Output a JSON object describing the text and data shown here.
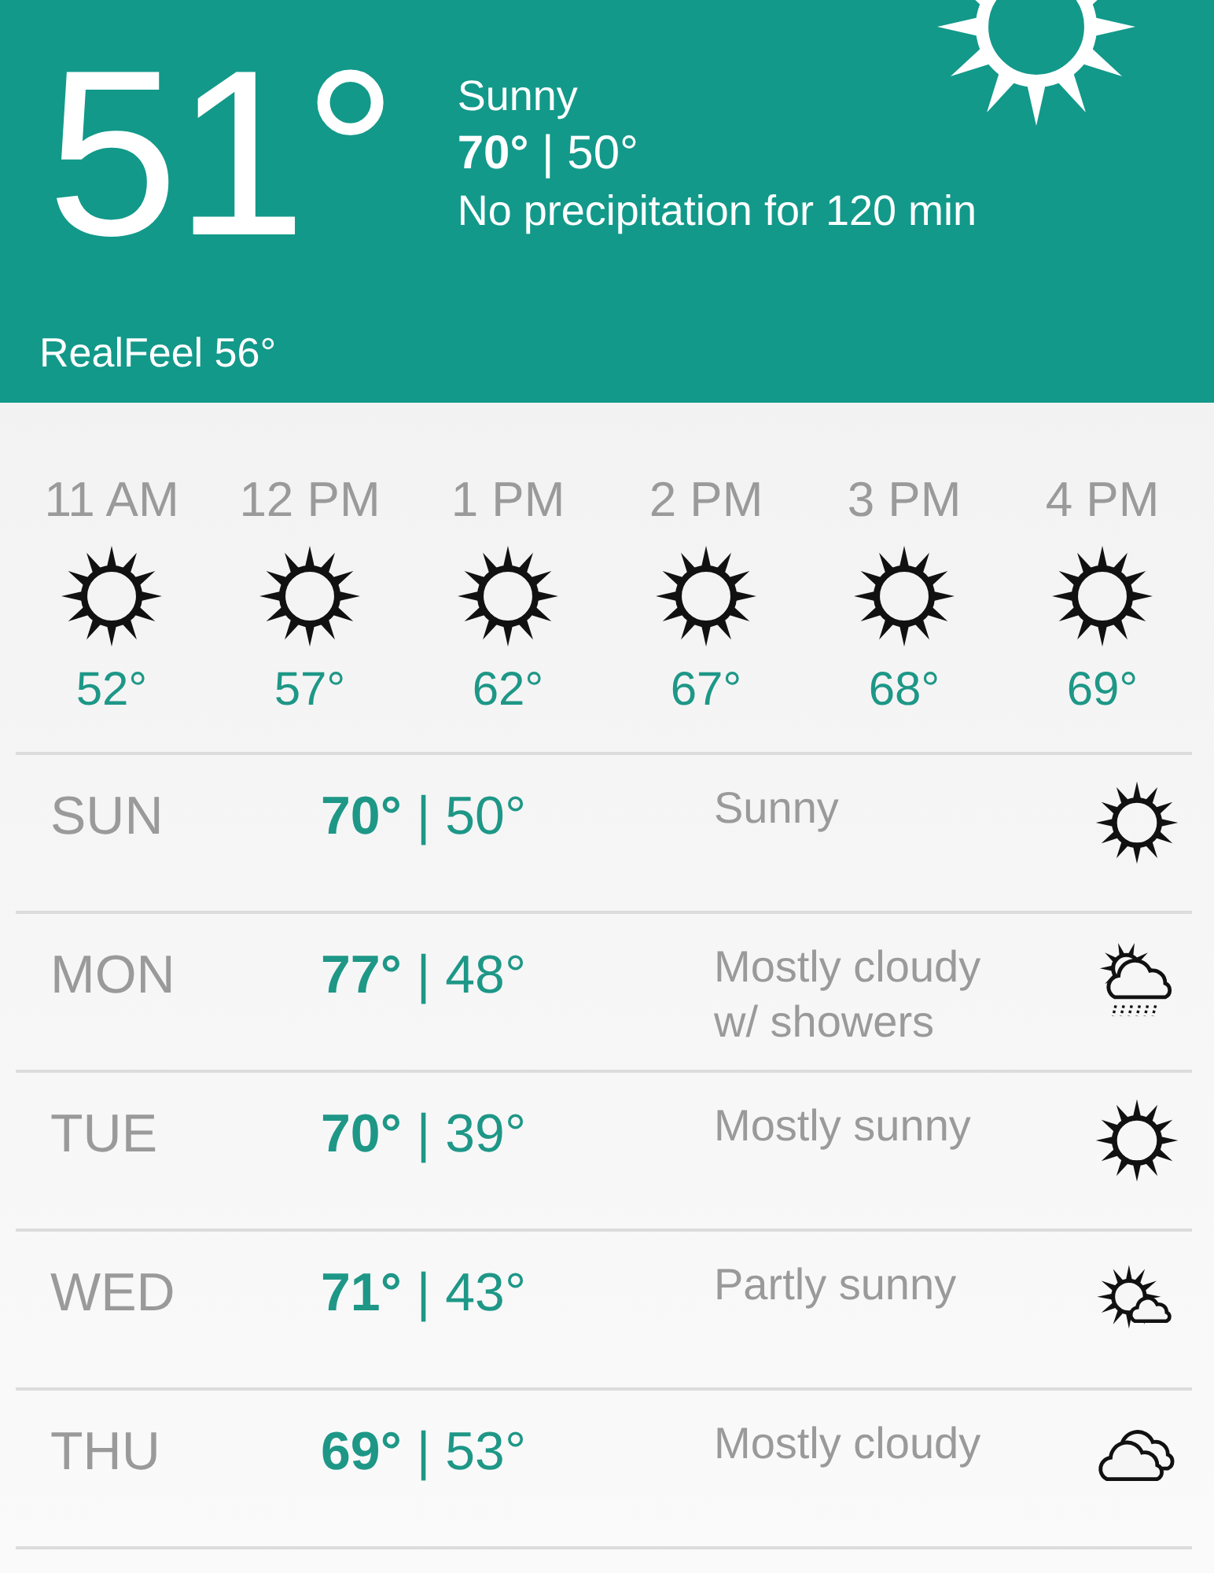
{
  "current": {
    "temperature": "51°",
    "kind": "sunny",
    "condition": "Sunny",
    "high_low": "**70°** | 50°",
    "precipitation": "No precipitation for 120 min",
    "realfeel": "RealFeel 56°"
  },
  "hourly": [
    {
      "time": "11 AM",
      "kind": "sunny",
      "temperature": "52°"
    },
    {
      "time": "12 PM",
      "kind": "sunny",
      "temperature": "57°"
    },
    {
      "time": "1 PM",
      "kind": "sunny",
      "temperature": "62°"
    },
    {
      "time": "2 PM",
      "kind": "sunny",
      "temperature": "67°"
    },
    {
      "time": "3 PM",
      "kind": "sunny",
      "temperature": "68°"
    },
    {
      "time": "4 PM",
      "kind": "sunny",
      "temperature": "69°"
    }
  ],
  "daily": [
    {
      "day": "SUN",
      "high_low": "**70°** | 50°",
      "condition": "Sunny",
      "kind": "sunny"
    },
    {
      "day": "MON",
      "high_low": "**77°** | 48°",
      "condition": "Mostly cloudy w/ showers",
      "kind": "showers"
    },
    {
      "day": "TUE",
      "high_low": "**70°** | 39°",
      "condition": "Mostly sunny",
      "kind": "sunny"
    },
    {
      "day": "WED",
      "high_low": "**71°** | 43°",
      "condition": "Partly sunny",
      "kind": "partly_sunny"
    },
    {
      "day": "THU",
      "high_low": "**69°** | 53°",
      "condition": "Mostly cloudy",
      "kind": "cloudy"
    }
  ]
}
